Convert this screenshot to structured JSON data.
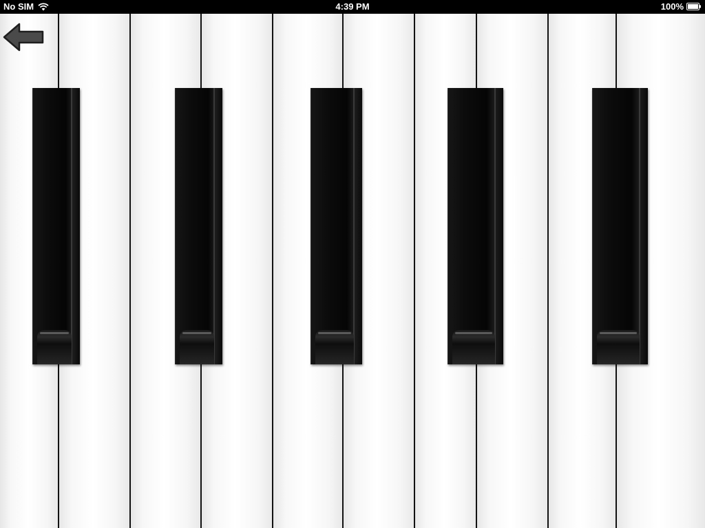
{
  "status_bar": {
    "carrier": "No SIM",
    "time": "4:39 PM",
    "battery": "100%",
    "wifi_icon": "wifi-icon",
    "battery_icon": "battery-icon"
  },
  "navigation": {
    "back_icon": "back-arrow-icon"
  },
  "keyboard": {
    "white_key_count": 10,
    "black_key_count": 5
  },
  "colors": {
    "white_key": "#f4f4f4",
    "black_key": "#0a0a0a",
    "status_bar": "#000000"
  }
}
